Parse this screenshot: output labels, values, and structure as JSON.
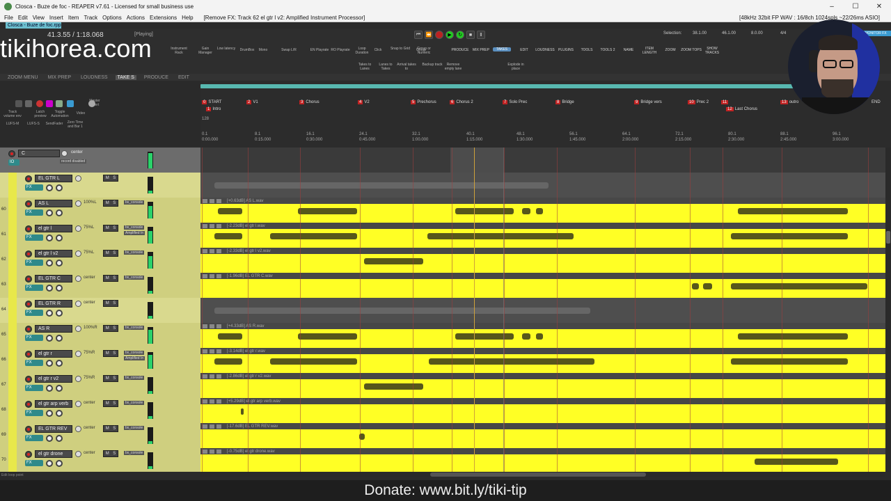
{
  "window": {
    "title": "Closca - Buze de foc - REAPER v7.61 - Licensed for small business use",
    "controls": [
      "–",
      "☐",
      "✕"
    ]
  },
  "menu": {
    "items": [
      "File",
      "Edit",
      "View",
      "Insert",
      "Item",
      "Track",
      "Options",
      "Actions",
      "Extensions",
      "Help"
    ],
    "fx_info": "[Remove FX: Track 62 el gtr l v2: Amplified Instrument Processor]",
    "audio_info": "[48kHz 32bit FP WAV : 16/8ch 1024spls ~22/26ms ASIO]"
  },
  "project_tab": "Closca - Buze de foc.rpp",
  "transport": {
    "time": "41.3.55 / 1:18.068",
    "state": "[Playing]",
    "selection_label": "Selection:",
    "sel_start": "38.1.00",
    "sel_end": "46.1.00",
    "sel_len": "8.0.00",
    "time_sig": "4/4"
  },
  "watermark": "tikihorea.com",
  "toolbar_buttons": [
    "Instrument Rack",
    "Gain Manager",
    "Low latency",
    "DrumBox",
    "Mono",
    "Swap L/R",
    "EN Playrate",
    "RO Playrate",
    "Loop Duration",
    "Click",
    "Snap to Grid",
    "Group",
    "Group or Numeric",
    "PRODUCE",
    "MIX PREP",
    "TAKES",
    "EDIT",
    "LOUDNESS",
    "PLUGINS",
    "TOOLS",
    "TOOLS 2",
    "NAME",
    "ITEM LENGTH",
    "ZOOM",
    "ZOOM TOPS",
    "SHOW TRACKS"
  ],
  "toolbar_row2": [
    "Takes to Lanes",
    "Lanes to Takes",
    "Arrival takes to",
    "Backup track",
    "Remove empty lane",
    "Explode in place"
  ],
  "rt_monitor": "MONITOR FX",
  "section_tabs": [
    "ZOOM MENU",
    "MIX PREP",
    "LOUDNESS",
    "TAKE S",
    "PRODUCE",
    "EDIT"
  ],
  "tcp_head_buttons": [
    "Track volume env",
    "Latch preview",
    "Toggle Automation",
    "Video",
    "Master Insert",
    "LUFS-M",
    "LUFS-S",
    "SendFader",
    "Zero Time and Bar 1"
  ],
  "markers": [
    {
      "n": "0",
      "label": "START"
    },
    {
      "n": "2",
      "label": "V1"
    },
    {
      "n": "3",
      "label": "Chorus"
    },
    {
      "n": "4",
      "label": "V2"
    },
    {
      "n": "5",
      "label": "Prechorus"
    },
    {
      "n": "6",
      "label": "Chorus 2"
    },
    {
      "n": "7",
      "label": "Solo Prec"
    },
    {
      "n": "8",
      "label": "Bridge"
    },
    {
      "n": "9",
      "label": "Bridge vers"
    },
    {
      "n": "10",
      "label": "Prec 2"
    },
    {
      "n": "11",
      "label": ""
    },
    {
      "n": "13",
      "label": "outro"
    },
    {
      "n": "",
      "label": "END"
    }
  ],
  "markers_row2": [
    {
      "n": "1",
      "label": "Intro"
    },
    {
      "n": "12",
      "label": "Last Chorus"
    }
  ],
  "tempo": "128",
  "ruler": [
    {
      "bar": "0.1",
      "time": "0:00.000"
    },
    {
      "bar": "8.1",
      "time": "0:15.000"
    },
    {
      "bar": "16.1",
      "time": "0:30.000"
    },
    {
      "bar": "24.1",
      "time": "0:45.000"
    },
    {
      "bar": "32.1",
      "time": "1:00.000"
    },
    {
      "bar": "40.1",
      "time": "1:15.000"
    },
    {
      "bar": "48.1",
      "time": "1:30.000"
    },
    {
      "bar": "56.1",
      "time": "1:45.000"
    },
    {
      "bar": "64.1",
      "time": "2:00.000"
    },
    {
      "bar": "72.1",
      "time": "2:15.000"
    },
    {
      "bar": "80.1",
      "time": "2:30.000"
    },
    {
      "bar": "88.1",
      "time": "2:45.000"
    },
    {
      "bar": "96.1",
      "time": "3:00.000"
    }
  ],
  "master": {
    "name": "C",
    "pan": "center",
    "fx": "record disabled"
  },
  "tracks": [
    {
      "num": "",
      "name": "EL GTR L",
      "pan": "",
      "kind": "folder"
    },
    {
      "num": "60",
      "name": "AS L",
      "pan": "100%L",
      "kind": "audio",
      "item": "[+0.63dB] AS L.wav",
      "fx": "bx_console"
    },
    {
      "num": "61",
      "name": "el gtr l",
      "pan": "75%L",
      "kind": "audio",
      "item": "[-2.23dB] el gtr l.wav",
      "fx": "bx_console",
      "fx2": "Amplified In"
    },
    {
      "num": "62",
      "name": "el gtr l v2",
      "pan": "75%L",
      "kind": "audio",
      "item": "[-2.33dB] el gtr l v2.wav",
      "fx": "bx_console"
    },
    {
      "num": "63",
      "name": "EL GTR C",
      "pan": "center",
      "kind": "audio",
      "item": "[-1.96dB] EL GTR C.wav",
      "fx": "bx_console"
    },
    {
      "num": "64",
      "name": "EL GTR R",
      "pan": "center",
      "kind": "folder"
    },
    {
      "num": "65",
      "name": "AS R",
      "pan": "100%R",
      "kind": "audio",
      "item": "[+4.33dB] AS R.wav",
      "fx": "bx_console"
    },
    {
      "num": "66",
      "name": "el gtr r",
      "pan": "75%R",
      "kind": "audio",
      "item": "[-3.14dB] el gtr r.wav",
      "fx": "bx_console",
      "fx2": "Amplified In"
    },
    {
      "num": "67",
      "name": "el gtr r v2",
      "pan": "75%R",
      "kind": "audio",
      "item": "[-2.86dB] el gtr r v2.wav",
      "fx": "bx_console"
    },
    {
      "num": "68",
      "name": "el gtr arp verb",
      "pan": "center",
      "kind": "audio",
      "item": "[+5.29dB] el gtr arp verb.wav",
      "fx": "bx_console"
    },
    {
      "num": "69",
      "name": "EL GTR REV",
      "pan": "center",
      "kind": "audio",
      "item": "[-17.6dB] EL GTR REV.wav",
      "fx": "bx_console"
    },
    {
      "num": "70",
      "name": "el gtr drone",
      "pan": "center",
      "kind": "audio",
      "item": "[-0.75dB] el gtr drone.wav",
      "fx": "bx_console"
    }
  ],
  "status_left": "Edit loop point",
  "donate": "Donate: www.bit.ly/tiki-tip",
  "colors": {
    "item": "#ffff25",
    "folder_tcp": "#d9d98e",
    "loopbar": "#58b8b0",
    "marker": "#c02222"
  }
}
